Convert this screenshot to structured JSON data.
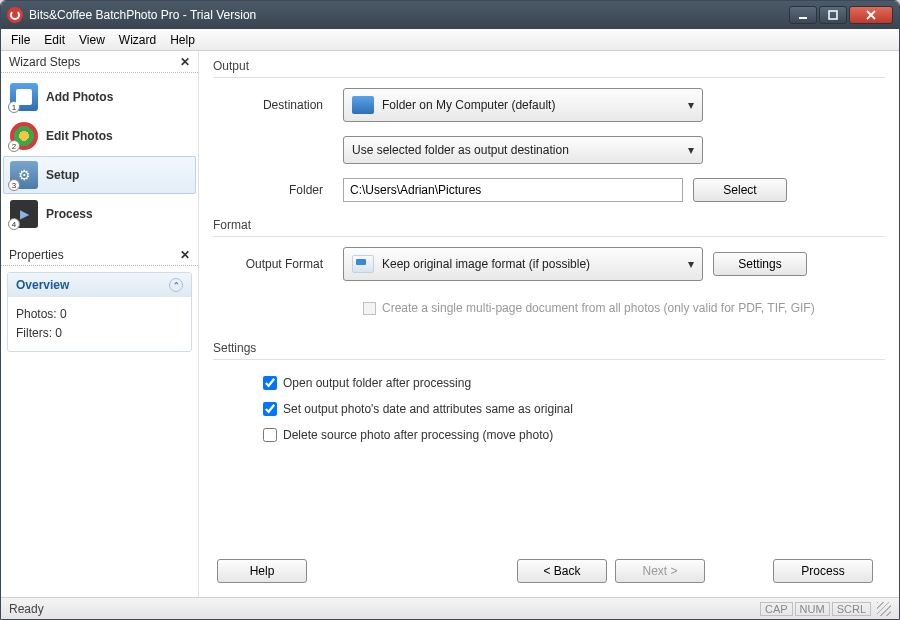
{
  "window": {
    "title": "Bits&Coffee BatchPhoto Pro - Trial Version"
  },
  "menu": {
    "file": "File",
    "edit": "Edit",
    "view": "View",
    "wizard": "Wizard",
    "help": "Help"
  },
  "sidebar": {
    "steps_title": "Wizard Steps",
    "items": [
      {
        "label": "Add Photos",
        "badge": "1"
      },
      {
        "label": "Edit Photos",
        "badge": "2"
      },
      {
        "label": "Setup",
        "badge": "3"
      },
      {
        "label": "Process",
        "badge": "4"
      }
    ],
    "props_title": "Properties",
    "overview_title": "Overview",
    "photos_label": "Photos: 0",
    "filters_label": "Filters: 0"
  },
  "output": {
    "section": "Output",
    "dest_label": "Destination",
    "dest_value": "Folder on My Computer (default)",
    "dest_mode_value": "Use selected folder as output destination",
    "folder_label": "Folder",
    "folder_value": "C:\\Users\\Adrian\\Pictures",
    "select_btn": "Select"
  },
  "format": {
    "section": "Format",
    "label": "Output Format",
    "value": "Keep original image format (if possible)",
    "settings_btn": "Settings",
    "multipage_label": "Create a single multi-page document from all photos (only valid for PDF, TIF, GIF)"
  },
  "settings": {
    "section": "Settings",
    "open_after": "Open output folder after processing",
    "same_date": "Set output photo's date and attributes same as original",
    "delete_source": "Delete source photo after processing (move photo)"
  },
  "footer": {
    "help": "Help",
    "back": "< Back",
    "next": "Next >",
    "process": "Process"
  },
  "status": {
    "ready": "Ready",
    "cap": "CAP",
    "num": "NUM",
    "scrl": "SCRL"
  }
}
